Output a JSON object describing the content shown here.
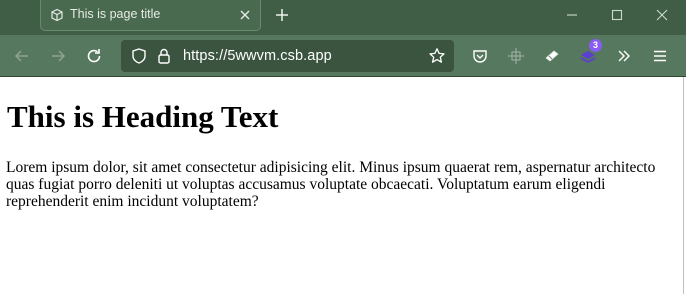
{
  "tab": {
    "title": "This is page title"
  },
  "window_controls": {
    "minimize": "minimize-icon",
    "maximize": "maximize-icon",
    "close": "close-icon"
  },
  "toolbar": {
    "url": "https://5wwvm.csb.app",
    "extension_badge_count": "3"
  },
  "page": {
    "heading": "This is Heading Text",
    "paragraph": "Lorem ipsum dolor, sit amet consectetur adipisicing elit. Minus ipsum quaerat rem, aspernatur architecto quas fugiat porro deleniti ut voluptas accusamus voluptate obcaecati. Voluptatum earum eligendi reprehenderit enim incidunt voluptatem?"
  },
  "colors": {
    "tabstrip_bg": "#3f5e45",
    "toolbar_bg": "#56785e",
    "urlbar_bg": "#3a5440",
    "badge_bg": "#8a5cf6"
  }
}
